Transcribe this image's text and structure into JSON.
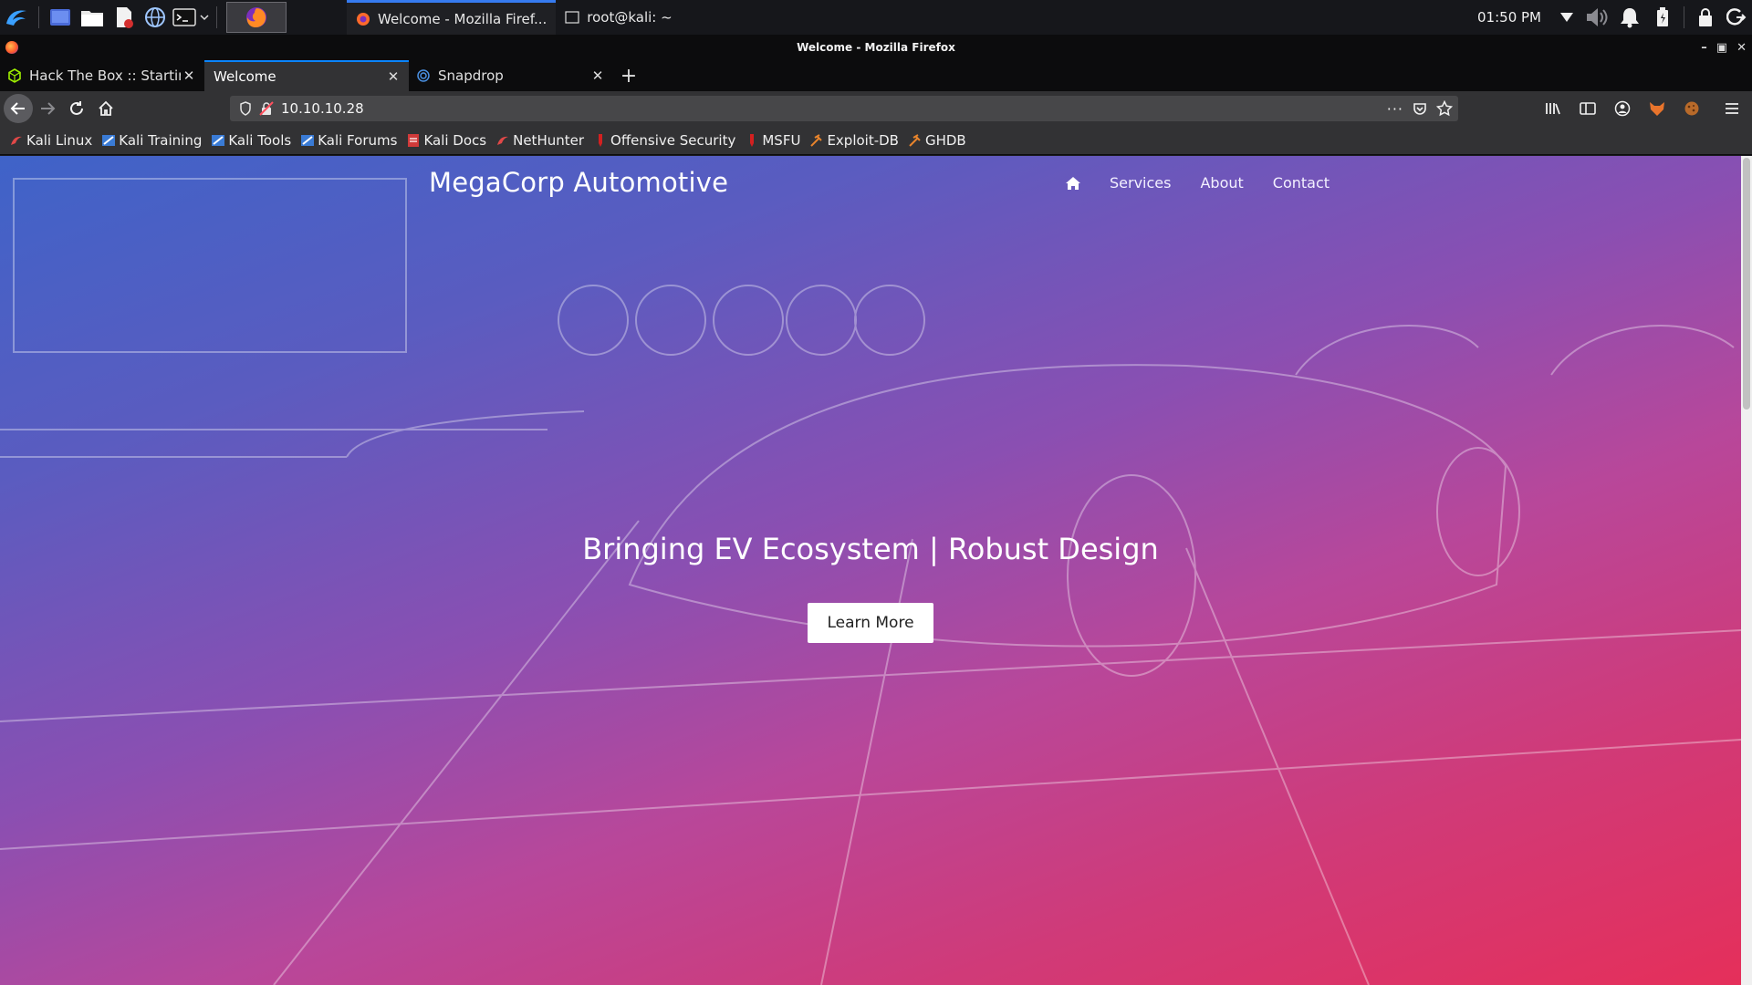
{
  "panel": {
    "taskbar_items": [
      {
        "label": "Welcome - Mozilla Firef..."
      },
      {
        "label": "root@kali: ~"
      }
    ],
    "clock": "01:50 PM"
  },
  "firefox": {
    "window_title": "Welcome - Mozilla Firefox",
    "tabs": [
      {
        "label": "Hack The Box :: Starting P"
      },
      {
        "label": "Welcome"
      },
      {
        "label": "Snapdrop"
      }
    ],
    "url": "10.10.10.28",
    "bookmarks": [
      {
        "label": "Kali Linux"
      },
      {
        "label": "Kali Training"
      },
      {
        "label": "Kali Tools"
      },
      {
        "label": "Kali Forums"
      },
      {
        "label": "Kali Docs"
      },
      {
        "label": "NetHunter"
      },
      {
        "label": "Offensive Security"
      },
      {
        "label": "MSFU"
      },
      {
        "label": "Exploit-DB"
      },
      {
        "label": "GHDB"
      }
    ]
  },
  "page": {
    "brand": "MegaCorp Automotive",
    "nav": {
      "services": "Services",
      "about": "About",
      "contact": "Contact"
    },
    "headline": "Bringing EV Ecosystem | Robust Design",
    "cta_label": "Learn More"
  },
  "colors": {
    "accent": "#0a84ff",
    "hero_start": "#3f63c8",
    "hero_end": "#e52f5a"
  }
}
